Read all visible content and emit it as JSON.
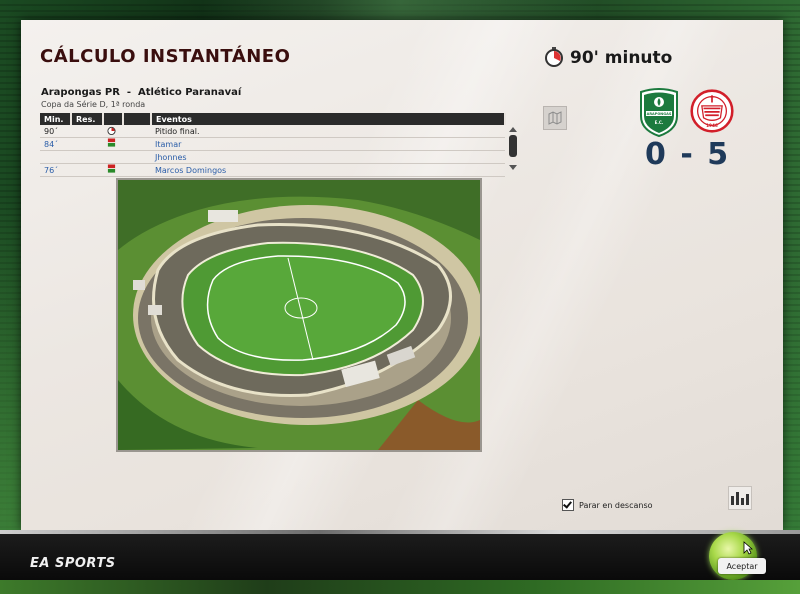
{
  "header": {
    "title": "CÁLCULO INSTANTÁNEO",
    "minute": "90' minuto"
  },
  "match": {
    "teams_line": "Arapongas PR  -  Atlético Paranavaí",
    "competition": "Copa da Série D, 1ª ronda",
    "score": "0 - 5",
    "home_crest_text": "ARAPONGAS E.C.",
    "away_crest_text": "1946"
  },
  "events_table": {
    "columns": [
      "Min.",
      "Res.",
      "",
      "",
      "Eventos"
    ],
    "rows": [
      {
        "min": "90´",
        "icon": "whistle-icon",
        "event": "Pitido final.",
        "link": false
      },
      {
        "min": "84´",
        "icon": "substitution-icon",
        "event": "Itamar",
        "link": true
      },
      {
        "min": "",
        "icon": "",
        "event": "Jhonnes",
        "link": true
      },
      {
        "min": "76´",
        "icon": "substitution-icon",
        "event": "Marcos Domingos",
        "link": true
      }
    ]
  },
  "controls": {
    "pause_checkbox_label": "Parar en descanso",
    "pause_checked": true,
    "accept_label": "Aceptar",
    "brand": "EA SPORTS"
  },
  "colors": {
    "title": "#3a0e0e",
    "score": "#1f3a5a",
    "link": "#2a5da8",
    "home_crest": "#1c7a3e",
    "away_crest": "#d21f2a"
  }
}
